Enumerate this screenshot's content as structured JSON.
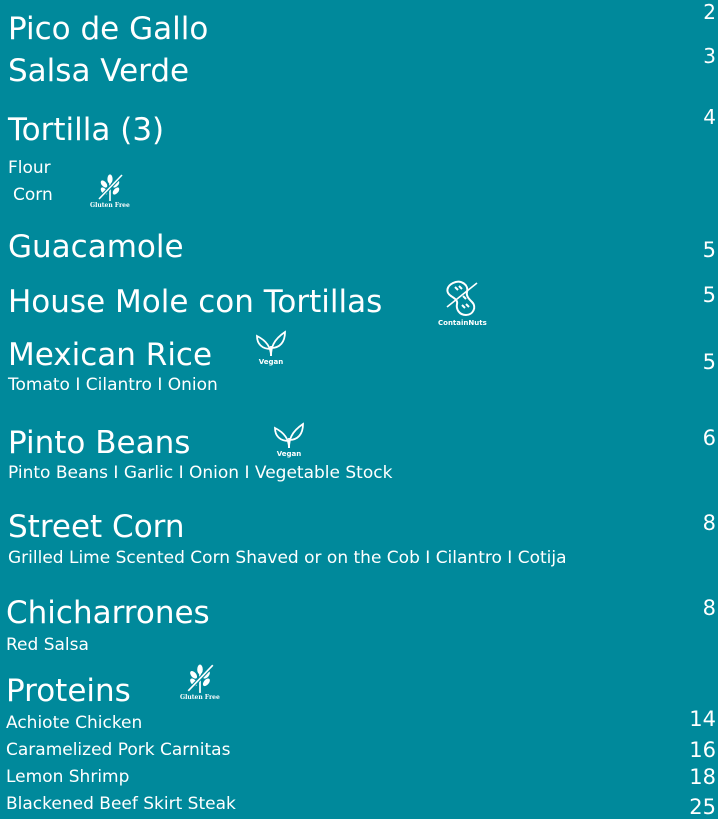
{
  "menu": {
    "pico": {
      "name": "Pico de Gallo",
      "price": "2"
    },
    "salsa": {
      "name": "Salsa Verde",
      "price": "3"
    },
    "tortilla": {
      "name": "Tortilla (3)",
      "price": "4",
      "option1": "Flour",
      "option2": "Corn"
    },
    "guacamole": {
      "name": "Guacamole",
      "price": "5"
    },
    "mole": {
      "name": "House Mole con Tortillas",
      "price": "5"
    },
    "rice": {
      "name": "Mexican Rice",
      "price": "5",
      "desc": "Tomato I Cilantro I Onion"
    },
    "beans": {
      "name": "Pinto Beans",
      "price": "6",
      "desc": "Pinto Beans I Garlic I Onion I Vegetable Stock"
    },
    "corn": {
      "name": "Street Corn",
      "price": "8",
      "desc": "Grilled Lime Scented Corn Shaved or on the Cob I Cilantro I Cotija"
    },
    "chicharrones": {
      "name": "Chicharrones",
      "price": "8",
      "desc": "Red Salsa"
    },
    "proteins": {
      "name": "Proteins",
      "items": [
        {
          "name": "Achiote Chicken",
          "price": "14"
        },
        {
          "name": "Caramelized Pork Carnitas",
          "price": "16"
        },
        {
          "name": "Lemon Shrimp",
          "price": "18"
        },
        {
          "name": "Blackened Beef Skirt Steak",
          "price": "25"
        }
      ]
    }
  },
  "icons": {
    "gluten_free_label": "Gluten Free",
    "vegan_label": "Vegan",
    "nuts_label": "ContainNuts",
    "gluten_free_icon": "gluten-free-icon",
    "vegan_icon": "vegan-leaf-icon",
    "nuts_icon": "peanut-icon"
  },
  "colors": {
    "background": "#00899b",
    "text": "#ffffff"
  }
}
